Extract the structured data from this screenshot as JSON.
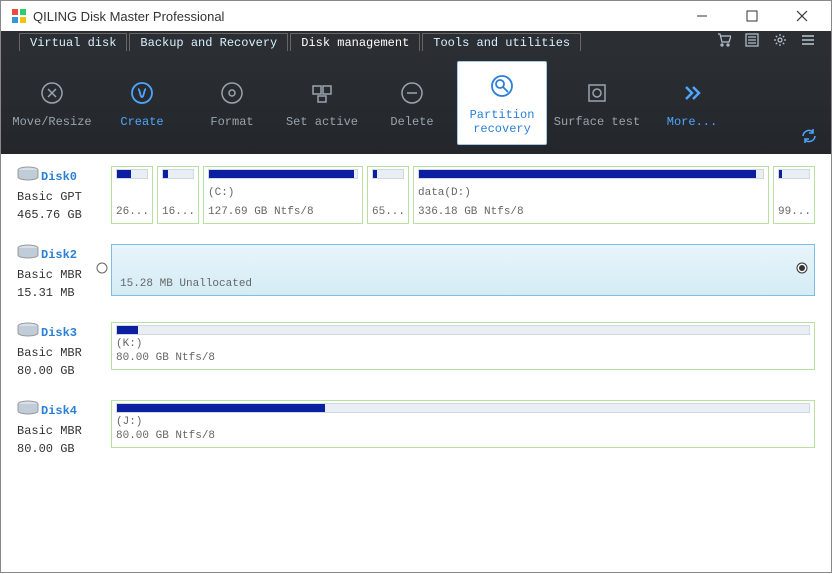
{
  "window": {
    "title": "QILING Disk Master Professional"
  },
  "tabs": {
    "t0": "Virtual disk",
    "t1": "Backup and Recovery",
    "t2": "Disk management",
    "t3": "Tools and utilities"
  },
  "toolbar": {
    "move": "Move/Resize",
    "create": "Create",
    "format": "Format",
    "setactive": "Set active",
    "delete": "Delete",
    "precov1": "Partition",
    "precov2": "recovery",
    "surface": "Surface test",
    "more": "More..."
  },
  "disks": {
    "d0": {
      "name": "Disk0",
      "type": "Basic GPT",
      "size": "465.76 GB",
      "p0": {
        "lbl": "26...",
        "fill": 45
      },
      "p1": {
        "lbl": "16...",
        "fill": 15
      },
      "p2": {
        "lbl1": "(C:)",
        "lbl2": "127.69 GB Ntfs/8",
        "fill": 98
      },
      "p3": {
        "lbl": "65...",
        "fill": 12
      },
      "p4": {
        "lbl1": "data(D:)",
        "lbl2": "336.18 GB Ntfs/8",
        "fill": 98
      },
      "p5": {
        "lbl": "99...",
        "fill": 10
      }
    },
    "d2": {
      "name": "Disk2",
      "type": "Basic MBR",
      "size": "15.31 MB",
      "p0": {
        "lbl": "15.28 MB Unallocated"
      }
    },
    "d3": {
      "name": "Disk3",
      "type": "Basic MBR",
      "size": "80.00 GB",
      "p0": {
        "lbl1": "(K:)",
        "lbl2": "80.00 GB Ntfs/8",
        "fill": 3
      }
    },
    "d4": {
      "name": "Disk4",
      "type": "Basic MBR",
      "size": "80.00 GB",
      "p0": {
        "lbl1": "(J:)",
        "lbl2": "80.00 GB Ntfs/8",
        "fill": 30
      }
    }
  }
}
